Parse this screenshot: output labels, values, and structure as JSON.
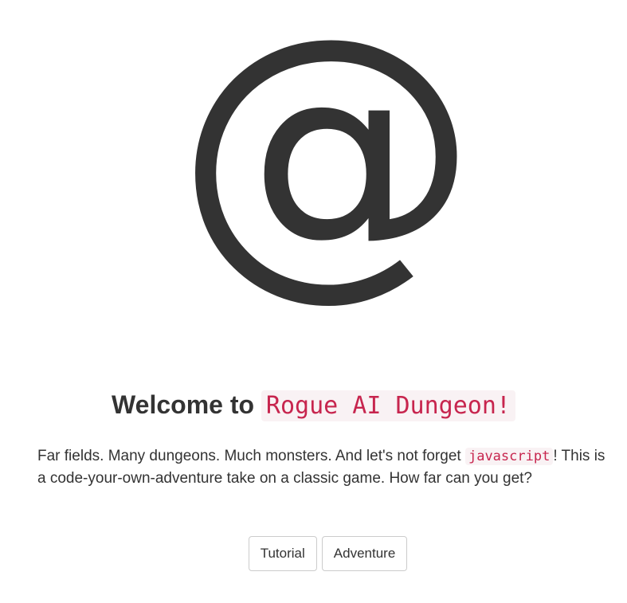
{
  "logo": {
    "glyph": "@",
    "icon": "at-sign-icon",
    "color": "#333333"
  },
  "heading": {
    "prefix": "Welcome to",
    "game_name": "Rogue AI Dungeon!"
  },
  "intro": {
    "text_before": "Far fields. Many dungeons. Much monsters. And let's not forget ",
    "code_word": "javascript",
    "text_after": "! This is a code-your-own-adventure take on a classic game. How far can you get?"
  },
  "buttons": {
    "tutorial": "Tutorial",
    "adventure": "Adventure"
  },
  "colors": {
    "text": "#333333",
    "code_text": "#c7254e",
    "code_background": "#f9f2f4",
    "button_border": "#cccccc"
  }
}
